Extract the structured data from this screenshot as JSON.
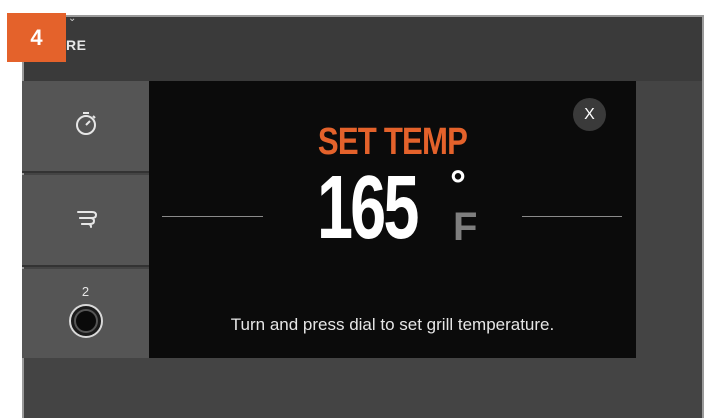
{
  "step_badge": "4",
  "header": {
    "label": "RE"
  },
  "sidebar": {
    "items": [
      {
        "icon": "timer-icon"
      },
      {
        "icon": "smoke-icon"
      },
      {
        "icon": "probe-port-icon",
        "label": "2"
      }
    ]
  },
  "modal": {
    "title": "SET TEMP",
    "temperature": "165",
    "degree_symbol": "°",
    "unit": "F",
    "close_label": "X",
    "instruction": "Turn and press dial to set grill temperature."
  },
  "colors": {
    "accent": "#e4622b",
    "background": "#0b0b0b",
    "panel": "#444444",
    "sidebar": "#555555"
  }
}
